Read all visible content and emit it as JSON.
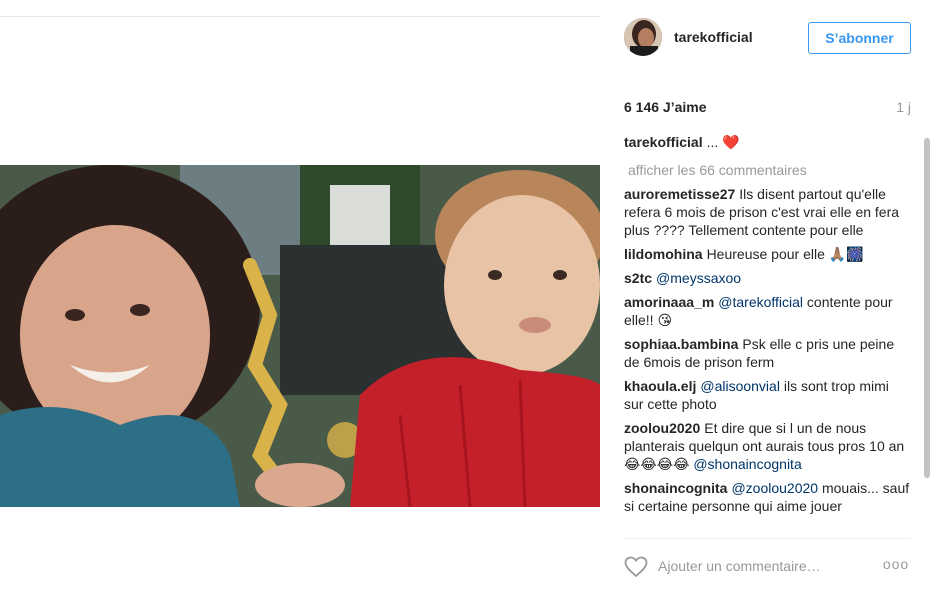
{
  "post": {
    "username": "tarekofficial",
    "follow_label": "S’abonner",
    "likes": "6 146 J’aime",
    "time": "1 j"
  },
  "caption": {
    "user": "tarekofficial",
    "text": "... ",
    "emoji": "❤️"
  },
  "load_more": "afficher les 66 commentaires",
  "comments": [
    {
      "user": "auroremetisse27",
      "text": "Ils disent partout qu'elle refera 6 mois de prison c'est vrai elle en fera plus ???? Tellement contente pour elle"
    },
    {
      "user": "lildomohina",
      "text": "Heureuse pour elle 🙏🏽🎆"
    },
    {
      "user": "s2tc",
      "mention": "@meyssaxoo",
      "text": ""
    },
    {
      "user": "amorinaaa_m",
      "mention": "@tarekofficial",
      "text": " contente pour elle!! 😘"
    },
    {
      "user": "sophiaa.bambina",
      "text": "Psk elle c pris une peine de 6mois de prison ferm"
    },
    {
      "user": "khaoula.elj",
      "mention": "@alisoonvial",
      "text": " ils sont trop mimi sur cette photo"
    },
    {
      "user": "zoolou2020",
      "text": "Et dire que si l un de nous planterais quelqun ont aurais tous pros 10 an 😂😂😂😂 ",
      "mention_after": "@shonaincognita"
    },
    {
      "user": "shonaincognita",
      "mention": "@zoolou2020",
      "text": " mouais... sauf si certaine personne qui aime jouer"
    }
  ],
  "footer": {
    "add_comment_placeholder": "Ajouter un commentaire…",
    "more_label": "ooo"
  },
  "colors": {
    "accent": "#3897f0",
    "mention": "#003569",
    "muted": "#999999"
  }
}
